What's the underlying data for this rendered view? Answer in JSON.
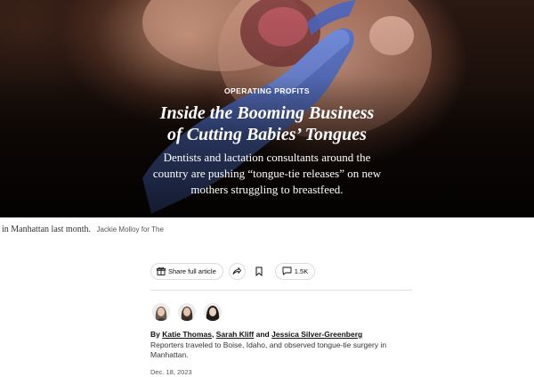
{
  "hero": {
    "kicker": "OPERATING PROFITS",
    "headline_lines": [
      "Inside the Booming Business",
      "of Cutting Babies’ Tongues"
    ],
    "dek_lines": [
      "Dentists and lactation consultants around the",
      "country are pushing “tongue-tie releases” on new",
      "mothers struggling to breastfeed."
    ]
  },
  "caption": {
    "text": "in Manhattan last month.",
    "credit": "Jackie Molloy for The"
  },
  "actions": {
    "share_label": "Share full article",
    "share_icon": "gift-icon",
    "forward_icon": "share-arrow-icon",
    "bookmark_icon": "bookmark-icon",
    "comments_icon": "comment-icon",
    "comments_count": "1.5K"
  },
  "byline": {
    "prefix": "By",
    "authors": [
      "Katie Thomas",
      "Sarah Kliff",
      "Jessica Silver-Greenberg"
    ],
    "sep1": ",",
    "and": "and",
    "reporting_note": "Reporters traveled to Boise, Idaho, and observed tongue-tie surgery in Manhattan.",
    "date": "Dec. 18, 2023"
  },
  "colors": {
    "glove": "#5b79d6",
    "text": "#121212",
    "divider": "#dfdfdf"
  }
}
